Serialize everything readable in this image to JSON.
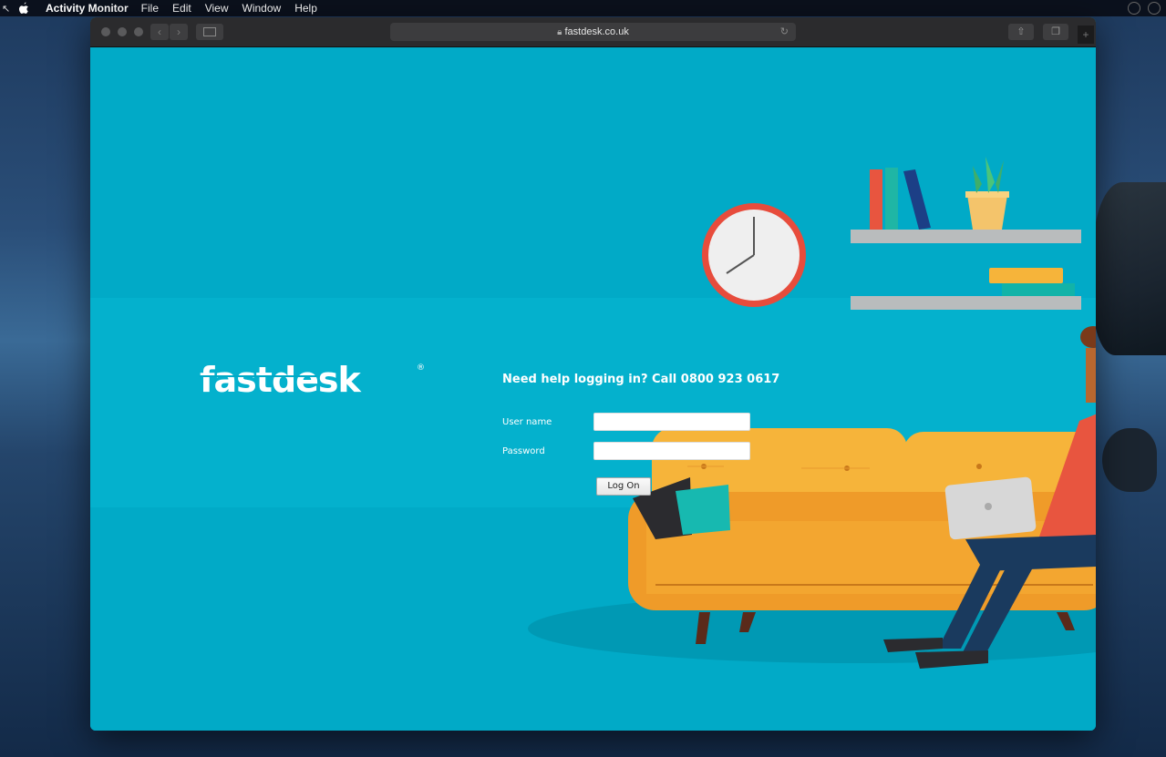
{
  "menubar": {
    "app_name": "Activity Monitor",
    "items": [
      "File",
      "Edit",
      "View",
      "Window",
      "Help"
    ]
  },
  "browser": {
    "url": "fastdesk.co.uk"
  },
  "page": {
    "logo_text": "fastdesk",
    "logo_mark": "®",
    "help_text": "Need help logging in? Call 0800 923 0617",
    "username_label": "User name",
    "password_label": "Password",
    "username_value": "",
    "password_value": "",
    "logon_label": "Log On"
  },
  "colors": {
    "page_background": "#01aac7",
    "sofa": "#f3a630",
    "clock_rim": "#e74c3c"
  }
}
